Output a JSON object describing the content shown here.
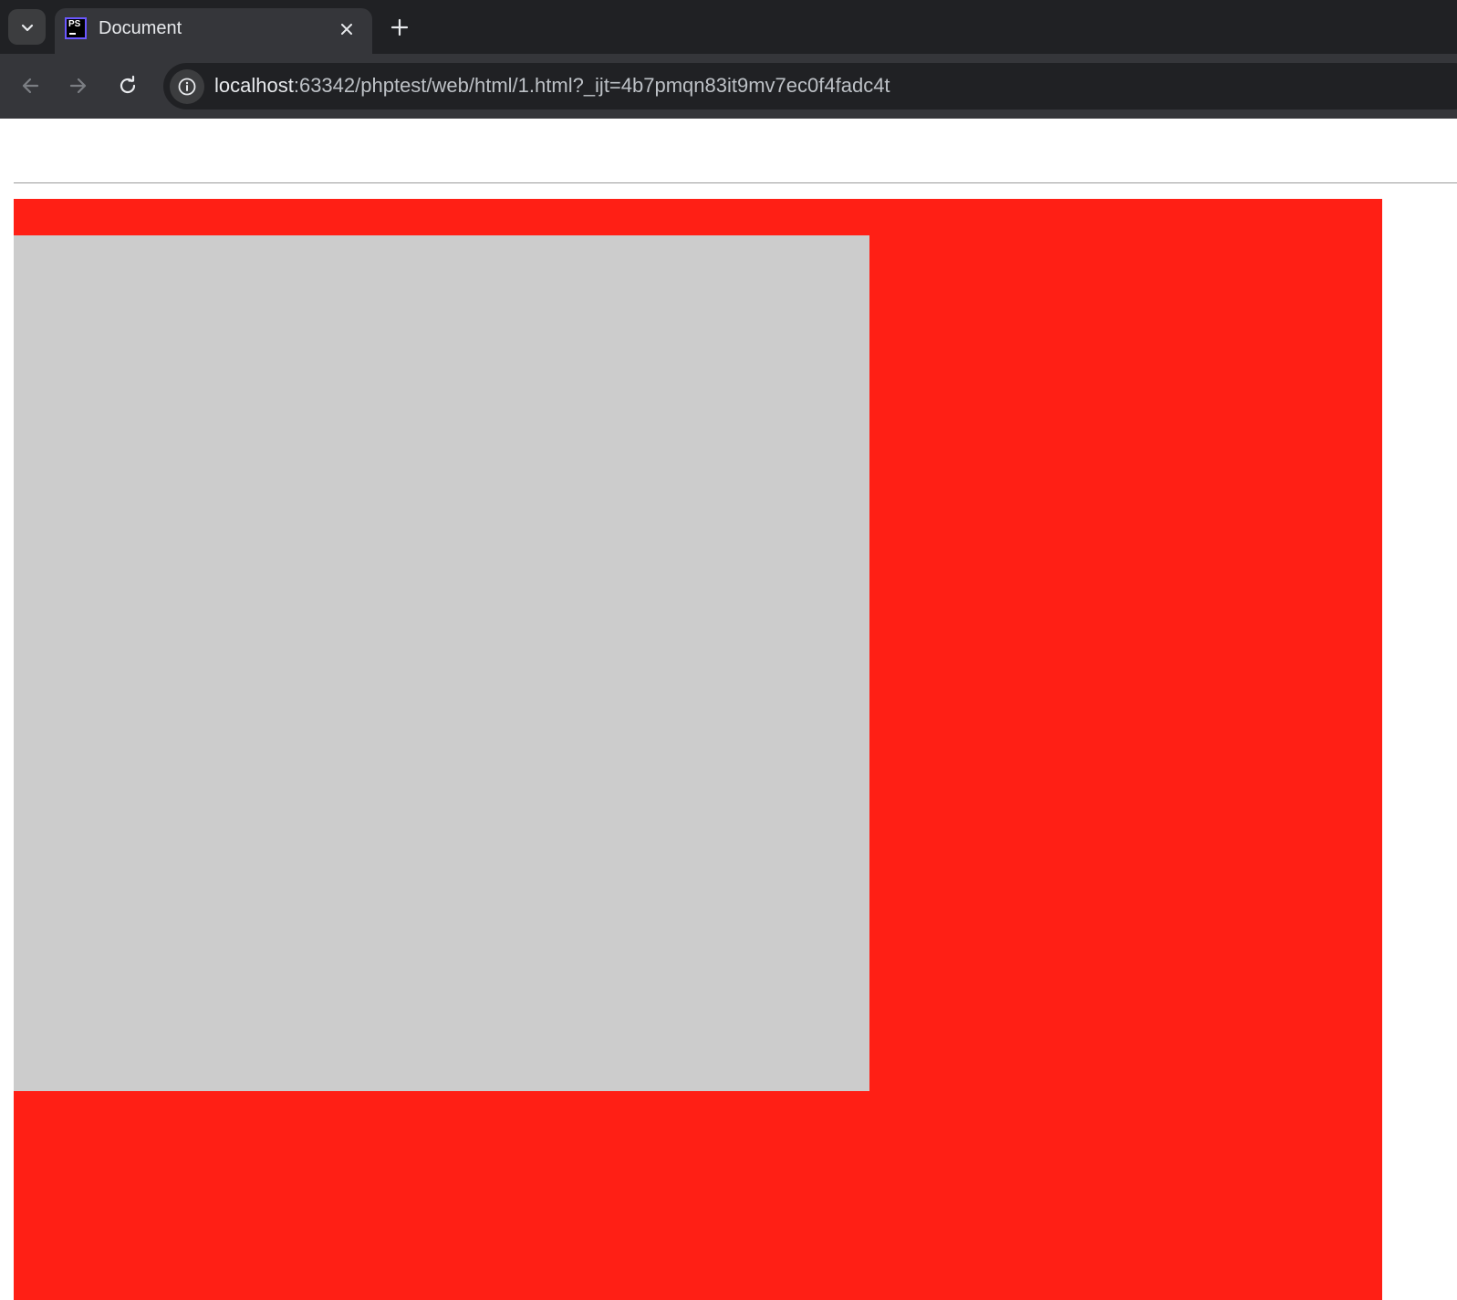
{
  "browser": {
    "tab": {
      "title": "Document",
      "favicon_text": "PS"
    },
    "address": {
      "host": "localhost",
      "rest": ":63342/phptest/web/html/1.html?_ijt=4b7pmqn83it9mv7ec0f4fadc4t"
    }
  },
  "icons": {
    "tab_search": "chevron-down-icon",
    "close": "close-icon",
    "new_tab": "plus-icon",
    "back": "arrow-left-icon",
    "forward": "arrow-right-icon",
    "reload": "reload-icon",
    "site_info": "info-icon"
  },
  "colors": {
    "outer_box": "#ff1f15",
    "inner_box": "#cccccc",
    "tabstrip": "#202124",
    "toolbar": "#35363a"
  }
}
